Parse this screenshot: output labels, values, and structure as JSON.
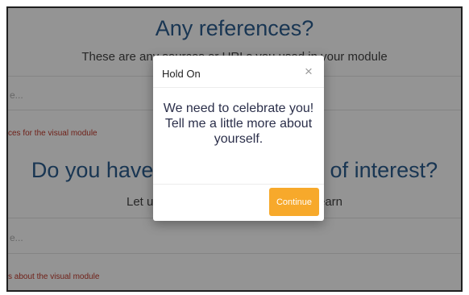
{
  "background": {
    "section1": {
      "title": "Any references?",
      "subtitle": "These are any sources or URLs you used in your module",
      "placeholder": "e...",
      "note": "ces for the visual module"
    },
    "section2": {
      "title": "Do you have any further areas of interest?",
      "subtitle": "Let us know what else you'd like to learn",
      "placeholder": "e...",
      "note": "s about the visual module"
    }
  },
  "modal": {
    "title": "Hold On",
    "close_icon": "×",
    "message": "We need to celebrate you! Tell me a little more about yourself.",
    "continue_label": "Continue",
    "accent_color": "#f7a92b"
  },
  "colors": {
    "heading": "#2c5d8f",
    "note": "#c0392b"
  }
}
